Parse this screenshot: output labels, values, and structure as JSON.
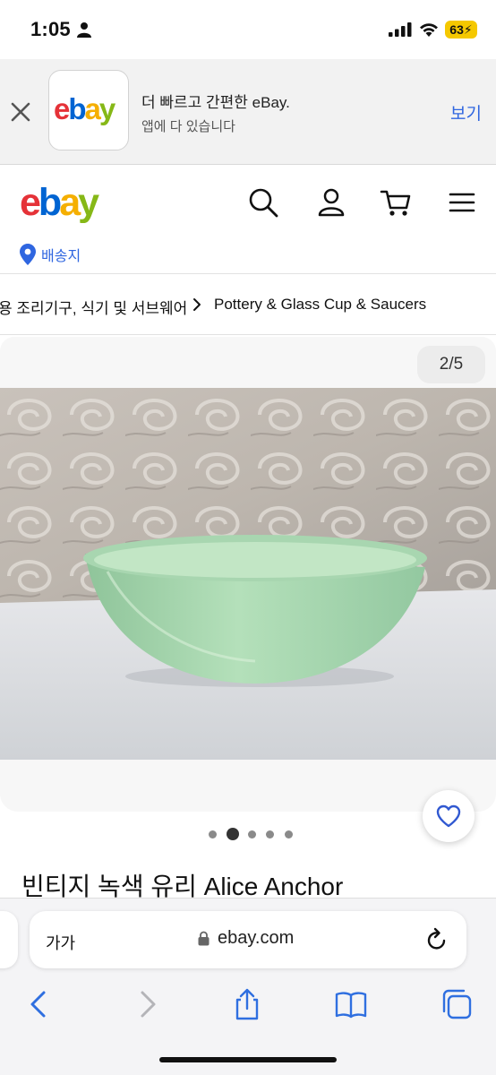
{
  "status_bar": {
    "time": "1:05",
    "battery": "63"
  },
  "app_banner": {
    "logo_text": "ebay",
    "title": "더 빠르고 간편한 eBay.",
    "subtitle": "앱에 다 있습니다",
    "view_label": "보기"
  },
  "header": {
    "logo_text": "ebay",
    "location_label": "배송지"
  },
  "breadcrumb": {
    "items": [
      "용 조리기구, 식기 및 서브웨어",
      "Pottery & Glass Cup & Saucers"
    ]
  },
  "gallery": {
    "counter": "2/5",
    "current_index": 2,
    "total_dots": 5
  },
  "item": {
    "title": "빈티지 녹색 유리 Alice Anchor"
  },
  "browser": {
    "text_size_label": "가가",
    "url": "ebay.com"
  },
  "colors": {
    "ebay_red": "#e53238",
    "ebay_blue": "#0064d2",
    "ebay_yellow": "#f5af02",
    "ebay_green": "#86b817",
    "link_blue": "#2f66e0",
    "safari_blue": "#2f6fe0"
  }
}
